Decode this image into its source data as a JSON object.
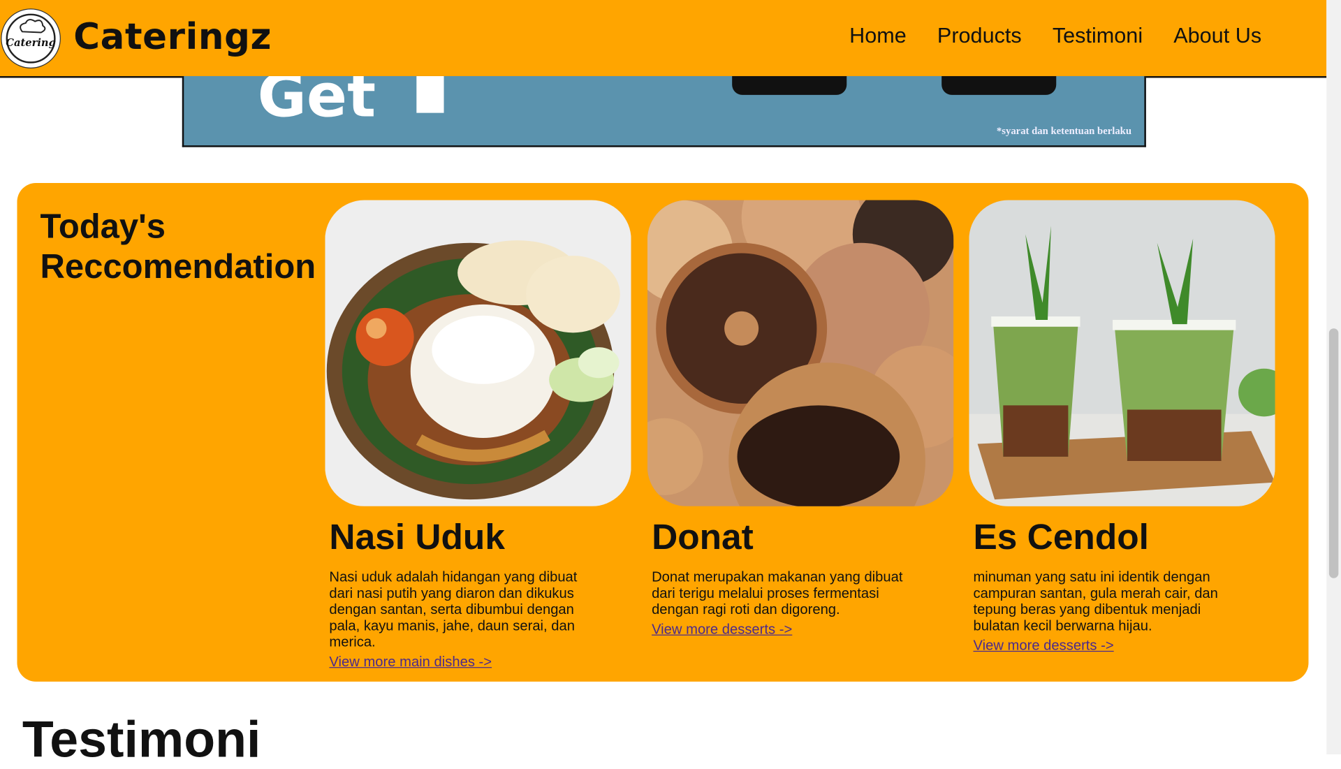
{
  "header": {
    "brand": "Cateringz",
    "logo_text": "Catering",
    "nav": [
      "Home",
      "Products",
      "Testimoni",
      "About Us"
    ]
  },
  "banner": {
    "headline": "Get",
    "terms": "*syarat dan ketentuan berlaku"
  },
  "recommendation": {
    "title": "Today's Reccomendation",
    "cards": [
      {
        "name": "Nasi Uduk",
        "description": "Nasi uduk adalah hidangan yang dibuat dari nasi putih yang diaron dan dikukus dengan santan, serta dibumbui dengan pala, kayu manis, jahe, daun serai, dan merica.",
        "link": "View more main dishes ->"
      },
      {
        "name": "Donat",
        "description": "Donat merupakan makanan yang dibuat dari terigu melalui proses fermentasi dengan ragi roti dan digoreng.",
        "link": "View more desserts ->"
      },
      {
        "name": "Es Cendol",
        "description": "minuman yang satu ini identik dengan campuran santan, gula merah cair, dan tepung beras yang dibentuk menjadi bulatan kecil berwarna hijau.",
        "link": "View more desserts ->"
      }
    ]
  },
  "testimoni": {
    "title": "Testimoni"
  },
  "colors": {
    "accent": "#FFA500",
    "banner": "#5b93ae"
  }
}
